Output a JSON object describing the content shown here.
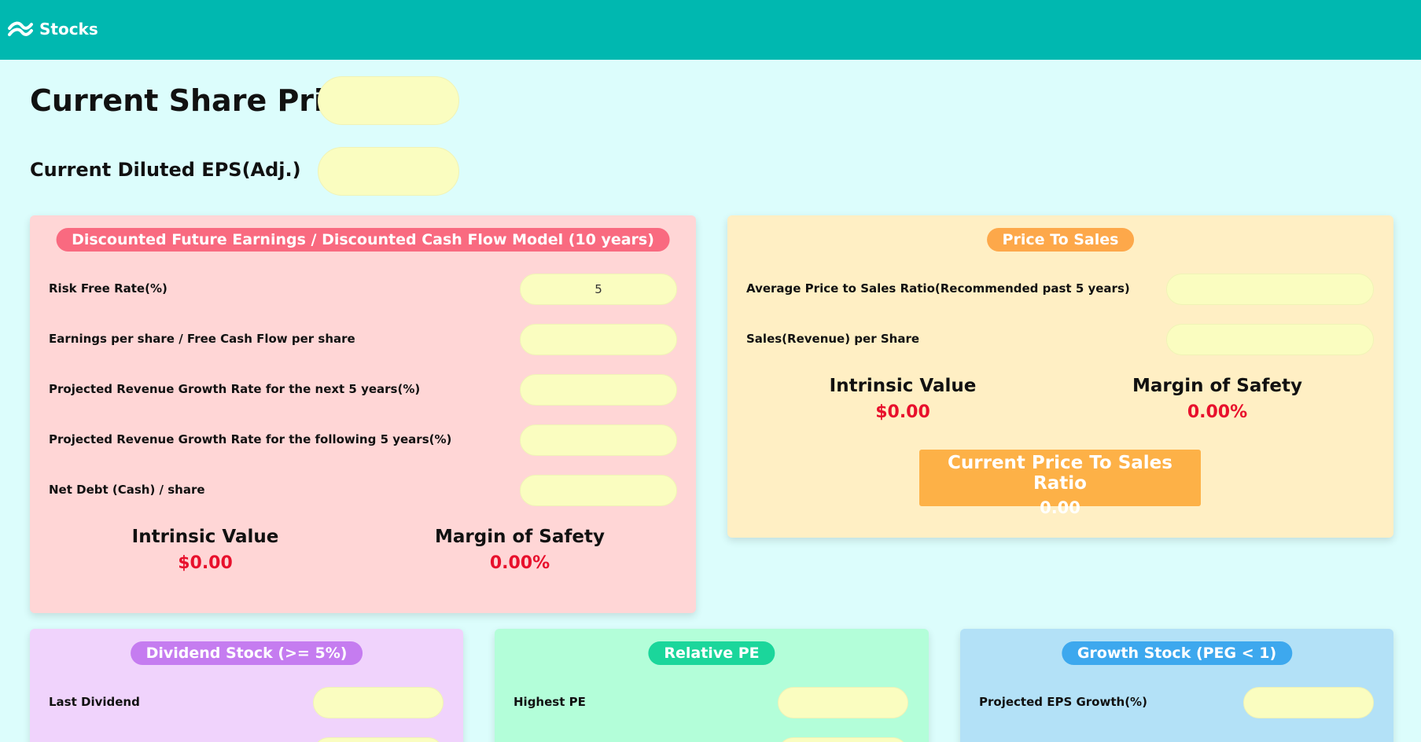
{
  "app": {
    "title": "Stocks",
    "accent": "#00b8b0"
  },
  "header": {
    "share_price_label": "Current Share Price",
    "share_price_value": "",
    "eps_label": "Current Diluted EPS(Adj.)",
    "eps_value": ""
  },
  "dcf": {
    "title": "Discounted Future Earnings / Discounted Cash Flow Model (10 years)",
    "fields": [
      {
        "label": "Risk Free Rate(%)",
        "value": "5"
      },
      {
        "label": "Earnings per share / Free Cash Flow per share",
        "value": ""
      },
      {
        "label": "Projected Revenue Growth Rate for the next 5 years(%)",
        "value": ""
      },
      {
        "label": "Projected Revenue Growth Rate for the following 5 years(%)",
        "value": ""
      },
      {
        "label": "Net Debt (Cash) / share",
        "value": ""
      }
    ],
    "intrinsic_label": "Intrinsic Value",
    "intrinsic_value": "$0.00",
    "margin_label": "Margin of Safety",
    "margin_value": "0.00%"
  },
  "price_to_sales": {
    "title": "Price To Sales",
    "fields": [
      {
        "label": "Average Price to Sales Ratio(Recommended past 5 years)",
        "value": ""
      },
      {
        "label": "Sales(Revenue) per Share",
        "value": ""
      }
    ],
    "intrinsic_label": "Intrinsic Value",
    "intrinsic_value": "$0.00",
    "margin_label": "Margin of Safety",
    "margin_value": "0.00%",
    "current_ratio_label": "Current Price To Sales Ratio",
    "current_ratio_value": "0.00"
  },
  "dividend": {
    "title": "Dividend Stock (>= 5%)",
    "fields": [
      {
        "label": "Last Dividend",
        "value": ""
      }
    ]
  },
  "relative_pe": {
    "title": "Relative PE",
    "fields": [
      {
        "label": "Highest PE",
        "value": ""
      }
    ]
  },
  "growth": {
    "title": "Growth Stock (PEG < 1)",
    "fields": [
      {
        "label": "Projected EPS Growth(%)",
        "value": ""
      }
    ]
  }
}
